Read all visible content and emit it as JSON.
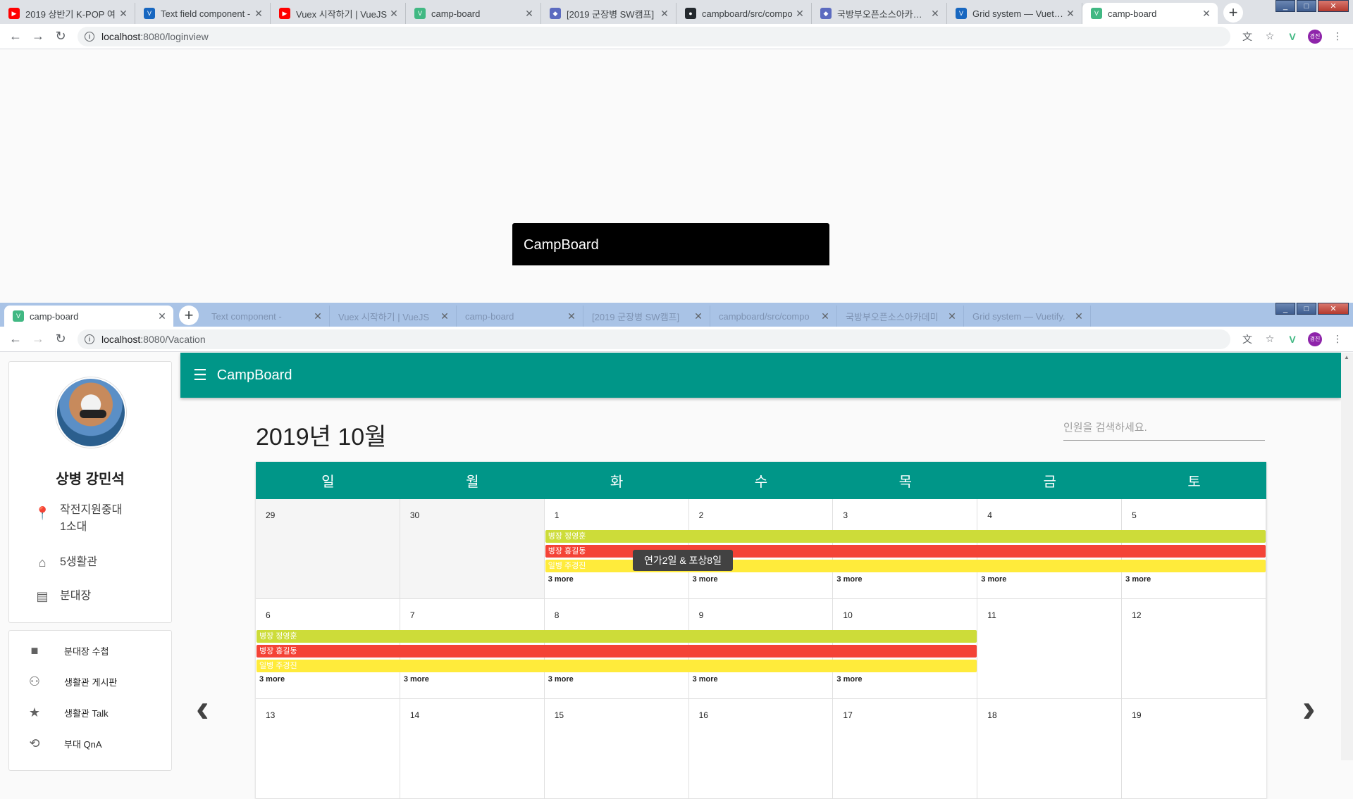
{
  "top_window": {
    "tabs": [
      {
        "title": "2019 상반기 K-POP 여",
        "fav_color": "#ff0000",
        "fav_glyph": "▶"
      },
      {
        "title": "Text field component -",
        "fav_color": "#1867c0",
        "fav_glyph": "V"
      },
      {
        "title": "Vuex 시작하기 | VueJS",
        "fav_color": "#ff0000",
        "fav_glyph": "▶"
      },
      {
        "title": "camp-board",
        "fav_color": "#41b883",
        "fav_glyph": "V"
      },
      {
        "title": "[2019 군장병 SW캠프]",
        "fav_color": "#5c6bc0",
        "fav_glyph": "◆"
      },
      {
        "title": "campboard/src/compo",
        "fav_color": "#24292e",
        "fav_glyph": "●"
      },
      {
        "title": "국방부오픈소스아카데미",
        "fav_color": "#5c6bc0",
        "fav_glyph": "◆"
      },
      {
        "title": "Grid system — Vuetify.",
        "fav_color": "#1867c0",
        "fav_glyph": "V"
      },
      {
        "title": "camp-board",
        "fav_color": "#41b883",
        "fav_glyph": "V",
        "active": true
      }
    ],
    "url_host": "localhost",
    "url_path": ":8080/loginview",
    "login_card_title": "CampBoard"
  },
  "bottom_window": {
    "tab_title": "camp-board",
    "ghost_tabs": [
      "Text component -",
      "Vuex 시작하기 | VueJS",
      "camp-board",
      "[2019 군장병 SW캠프]",
      "campboard/src/compo",
      "국방부오픈소스아카데미",
      "Grid system — Vuetify."
    ],
    "url_host": "localhost",
    "url_path": ":8080/Vacation",
    "avatar_initials": "경진"
  },
  "app": {
    "title": "CampBoard",
    "profile": {
      "name": "상병 강민석",
      "unit_line1": "작전지원중대",
      "unit_line2": "1소대",
      "barracks": "5생활관",
      "role": "분대장"
    },
    "menu": [
      {
        "label": "분대장 수첩",
        "icon": "folder-icon",
        "glyph": "■"
      },
      {
        "label": "생활관 게시판",
        "icon": "people-icon",
        "glyph": "👥"
      },
      {
        "label": "생활관 Talk",
        "icon": "star-icon",
        "glyph": "★"
      },
      {
        "label": "부대 QnA",
        "icon": "history-icon",
        "glyph": "⟲"
      }
    ],
    "month_title": "2019년 10월",
    "search_placeholder": "인원을 검색하세요.",
    "weekdays": [
      "일",
      "월",
      "화",
      "수",
      "목",
      "금",
      "토"
    ],
    "weeks": [
      {
        "days": [
          "29",
          "30",
          "1",
          "2",
          "3",
          "4",
          "5"
        ],
        "outside": [
          0,
          1
        ]
      },
      {
        "days": [
          "6",
          "7",
          "8",
          "9",
          "10",
          "11",
          "12"
        ],
        "outside": []
      },
      {
        "days": [
          "13",
          "14",
          "15",
          "16",
          "17",
          "18",
          "19"
        ],
        "outside": []
      }
    ],
    "events": {
      "green": "병장 정영훈",
      "red": "병장 홍길동",
      "yellow": "일병 주경진"
    },
    "more_label": "3 more",
    "tooltip": "연가2일 & 포상8일",
    "colors": {
      "primary": "#009688",
      "green": "#cddc39",
      "red": "#f44336",
      "yellow": "#ffeb3b"
    }
  }
}
